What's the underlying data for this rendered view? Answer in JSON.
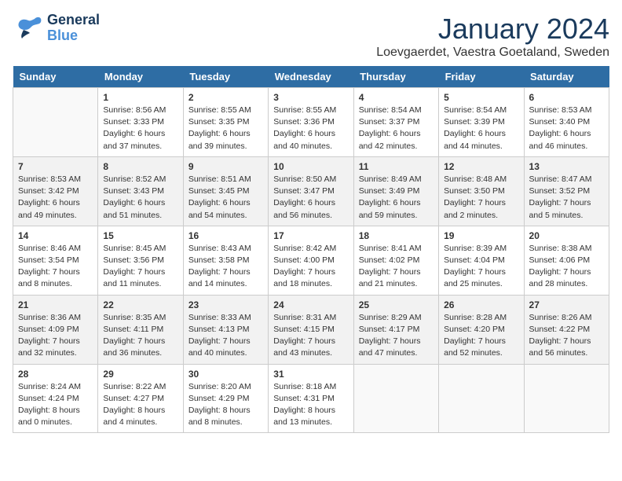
{
  "logo": {
    "general": "General",
    "blue": "Blue"
  },
  "title": "January 2024",
  "subtitle": "Loevgaerdet, Vaestra Goetaland, Sweden",
  "weekdays": [
    "Sunday",
    "Monday",
    "Tuesday",
    "Wednesday",
    "Thursday",
    "Friday",
    "Saturday"
  ],
  "weeks": [
    [
      {
        "day": "",
        "info": ""
      },
      {
        "day": "1",
        "info": "Sunrise: 8:56 AM\nSunset: 3:33 PM\nDaylight: 6 hours\nand 37 minutes."
      },
      {
        "day": "2",
        "info": "Sunrise: 8:55 AM\nSunset: 3:35 PM\nDaylight: 6 hours\nand 39 minutes."
      },
      {
        "day": "3",
        "info": "Sunrise: 8:55 AM\nSunset: 3:36 PM\nDaylight: 6 hours\nand 40 minutes."
      },
      {
        "day": "4",
        "info": "Sunrise: 8:54 AM\nSunset: 3:37 PM\nDaylight: 6 hours\nand 42 minutes."
      },
      {
        "day": "5",
        "info": "Sunrise: 8:54 AM\nSunset: 3:39 PM\nDaylight: 6 hours\nand 44 minutes."
      },
      {
        "day": "6",
        "info": "Sunrise: 8:53 AM\nSunset: 3:40 PM\nDaylight: 6 hours\nand 46 minutes."
      }
    ],
    [
      {
        "day": "7",
        "info": "Sunrise: 8:53 AM\nSunset: 3:42 PM\nDaylight: 6 hours\nand 49 minutes."
      },
      {
        "day": "8",
        "info": "Sunrise: 8:52 AM\nSunset: 3:43 PM\nDaylight: 6 hours\nand 51 minutes."
      },
      {
        "day": "9",
        "info": "Sunrise: 8:51 AM\nSunset: 3:45 PM\nDaylight: 6 hours\nand 54 minutes."
      },
      {
        "day": "10",
        "info": "Sunrise: 8:50 AM\nSunset: 3:47 PM\nDaylight: 6 hours\nand 56 minutes."
      },
      {
        "day": "11",
        "info": "Sunrise: 8:49 AM\nSunset: 3:49 PM\nDaylight: 6 hours\nand 59 minutes."
      },
      {
        "day": "12",
        "info": "Sunrise: 8:48 AM\nSunset: 3:50 PM\nDaylight: 7 hours\nand 2 minutes."
      },
      {
        "day": "13",
        "info": "Sunrise: 8:47 AM\nSunset: 3:52 PM\nDaylight: 7 hours\nand 5 minutes."
      }
    ],
    [
      {
        "day": "14",
        "info": "Sunrise: 8:46 AM\nSunset: 3:54 PM\nDaylight: 7 hours\nand 8 minutes."
      },
      {
        "day": "15",
        "info": "Sunrise: 8:45 AM\nSunset: 3:56 PM\nDaylight: 7 hours\nand 11 minutes."
      },
      {
        "day": "16",
        "info": "Sunrise: 8:43 AM\nSunset: 3:58 PM\nDaylight: 7 hours\nand 14 minutes."
      },
      {
        "day": "17",
        "info": "Sunrise: 8:42 AM\nSunset: 4:00 PM\nDaylight: 7 hours\nand 18 minutes."
      },
      {
        "day": "18",
        "info": "Sunrise: 8:41 AM\nSunset: 4:02 PM\nDaylight: 7 hours\nand 21 minutes."
      },
      {
        "day": "19",
        "info": "Sunrise: 8:39 AM\nSunset: 4:04 PM\nDaylight: 7 hours\nand 25 minutes."
      },
      {
        "day": "20",
        "info": "Sunrise: 8:38 AM\nSunset: 4:06 PM\nDaylight: 7 hours\nand 28 minutes."
      }
    ],
    [
      {
        "day": "21",
        "info": "Sunrise: 8:36 AM\nSunset: 4:09 PM\nDaylight: 7 hours\nand 32 minutes."
      },
      {
        "day": "22",
        "info": "Sunrise: 8:35 AM\nSunset: 4:11 PM\nDaylight: 7 hours\nand 36 minutes."
      },
      {
        "day": "23",
        "info": "Sunrise: 8:33 AM\nSunset: 4:13 PM\nDaylight: 7 hours\nand 40 minutes."
      },
      {
        "day": "24",
        "info": "Sunrise: 8:31 AM\nSunset: 4:15 PM\nDaylight: 7 hours\nand 43 minutes."
      },
      {
        "day": "25",
        "info": "Sunrise: 8:29 AM\nSunset: 4:17 PM\nDaylight: 7 hours\nand 47 minutes."
      },
      {
        "day": "26",
        "info": "Sunrise: 8:28 AM\nSunset: 4:20 PM\nDaylight: 7 hours\nand 52 minutes."
      },
      {
        "day": "27",
        "info": "Sunrise: 8:26 AM\nSunset: 4:22 PM\nDaylight: 7 hours\nand 56 minutes."
      }
    ],
    [
      {
        "day": "28",
        "info": "Sunrise: 8:24 AM\nSunset: 4:24 PM\nDaylight: 8 hours\nand 0 minutes."
      },
      {
        "day": "29",
        "info": "Sunrise: 8:22 AM\nSunset: 4:27 PM\nDaylight: 8 hours\nand 4 minutes."
      },
      {
        "day": "30",
        "info": "Sunrise: 8:20 AM\nSunset: 4:29 PM\nDaylight: 8 hours\nand 8 minutes."
      },
      {
        "day": "31",
        "info": "Sunrise: 8:18 AM\nSunset: 4:31 PM\nDaylight: 8 hours\nand 13 minutes."
      },
      {
        "day": "",
        "info": ""
      },
      {
        "day": "",
        "info": ""
      },
      {
        "day": "",
        "info": ""
      }
    ]
  ]
}
